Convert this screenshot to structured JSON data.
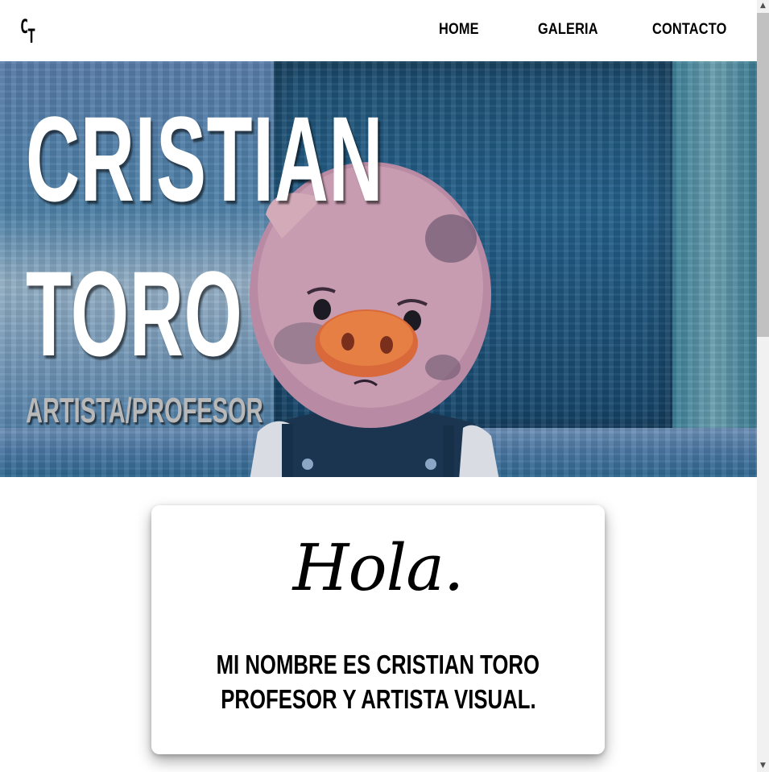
{
  "header": {
    "logo_top": "C",
    "logo_bottom": "T",
    "nav": {
      "home": "HOME",
      "galeria": "GALERIA",
      "contacto": "CONTACTO"
    }
  },
  "hero": {
    "title_line1": "CRISTIAN",
    "title_line2": "TORO",
    "subtitle": "ARTISTA/PROFESOR",
    "image_subject": "painted pig looking through a blue window"
  },
  "card": {
    "greeting": "Hola.",
    "line1": "MI NOMBRE ES CRISTIAN TORO",
    "line2": "PROFESOR Y ARTISTA VISUAL."
  },
  "scrollbar": {
    "up_glyph": "▲",
    "down_glyph": "▼"
  },
  "colors": {
    "text": "#000000",
    "hero_title": "#ffffff",
    "hero_subtitle": "#b8b8b8",
    "hero_blue": "#2f6f8f"
  }
}
